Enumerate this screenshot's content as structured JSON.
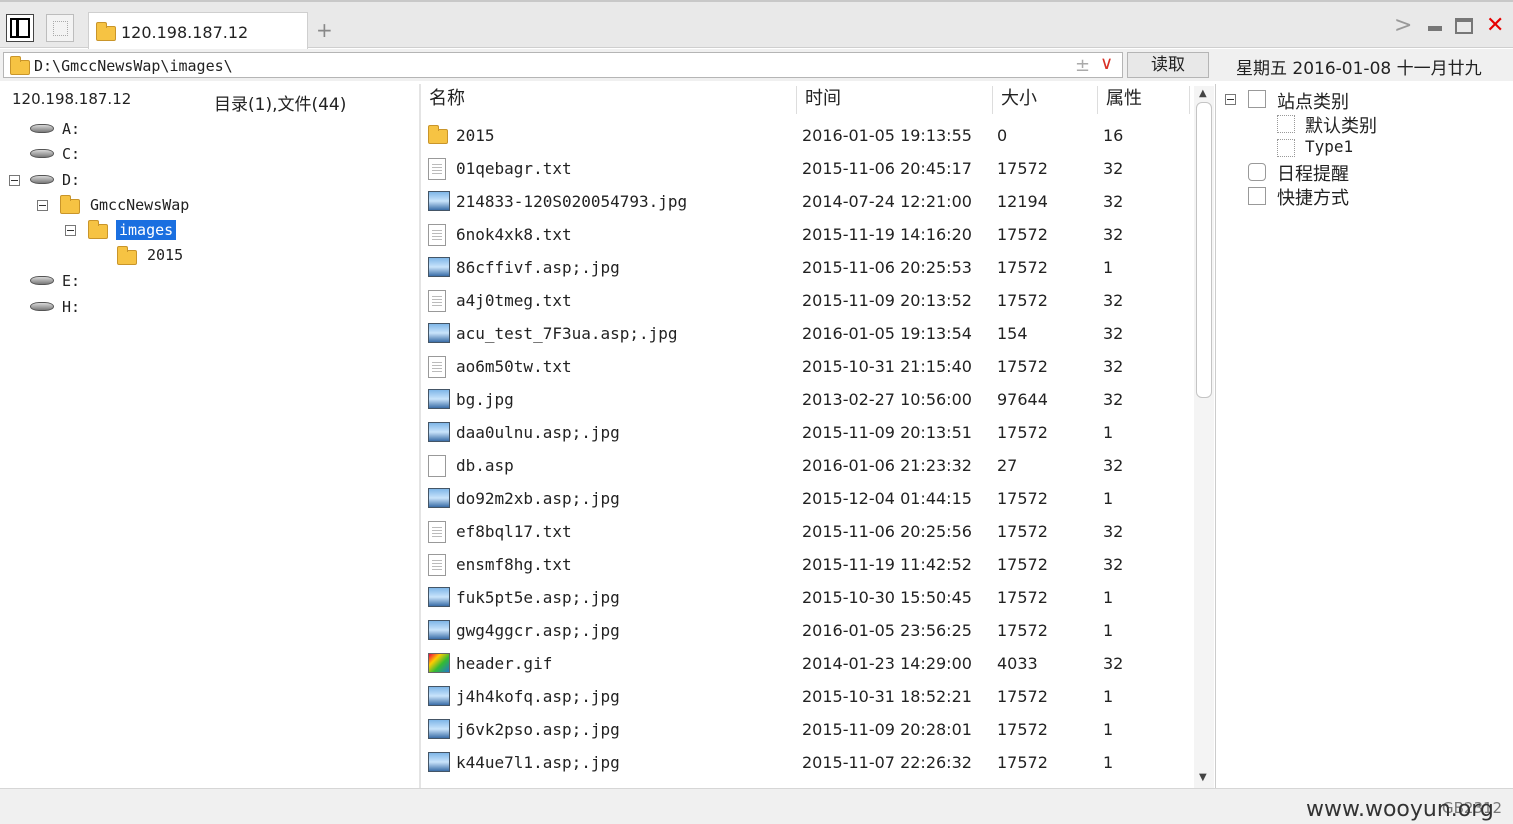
{
  "tabbar": {
    "tab_title": "120.198.187.12"
  },
  "address": {
    "path": "D:\\GmccNewsWap\\images\\",
    "read_button": "读取",
    "date": "星期五 2016-01-08 十一月廿九"
  },
  "left": {
    "host": "120.198.187.12",
    "counts": "目录(1),文件(44)",
    "tree": {
      "a": "A:",
      "c": "C:",
      "d": "D:",
      "gmcc": "GmccNewsWap",
      "images": "images",
      "y2015": "2015",
      "e": "E:",
      "h": "H:"
    }
  },
  "columns": {
    "name": "名称",
    "time": "时间",
    "size": "大小",
    "attr": "属性"
  },
  "files": [
    {
      "type": "folder",
      "name": "2015",
      "time": "2016-01-05 19:13:55",
      "size": "0",
      "attr": "16"
    },
    {
      "type": "txt",
      "name": "01qebagr.txt",
      "time": "2015-11-06 20:45:17",
      "size": "17572",
      "attr": "32"
    },
    {
      "type": "jpg",
      "name": "214833-120S020054793.jpg",
      "time": "2014-07-24 12:21:00",
      "size": "12194",
      "attr": "32"
    },
    {
      "type": "txt",
      "name": "6nok4xk8.txt",
      "time": "2015-11-19 14:16:20",
      "size": "17572",
      "attr": "32"
    },
    {
      "type": "jpg",
      "name": "86cffivf.asp;.jpg",
      "time": "2015-11-06 20:25:53",
      "size": "17572",
      "attr": "1"
    },
    {
      "type": "txt",
      "name": "a4j0tmeg.txt",
      "time": "2015-11-09 20:13:52",
      "size": "17572",
      "attr": "32"
    },
    {
      "type": "jpg",
      "name": "acu_test_7F3ua.asp;.jpg",
      "time": "2016-01-05 19:13:54",
      "size": "154",
      "attr": "32"
    },
    {
      "type": "txt",
      "name": "ao6m50tw.txt",
      "time": "2015-10-31 21:15:40",
      "size": "17572",
      "attr": "32"
    },
    {
      "type": "jpg",
      "name": "bg.jpg",
      "time": "2013-02-27 10:56:00",
      "size": "97644",
      "attr": "32"
    },
    {
      "type": "jpg",
      "name": "daa0ulnu.asp;.jpg",
      "time": "2015-11-09 20:13:51",
      "size": "17572",
      "attr": "1"
    },
    {
      "type": "asp",
      "name": "db.asp",
      "time": "2016-01-06 21:23:32",
      "size": "27",
      "attr": "32"
    },
    {
      "type": "jpg",
      "name": "do92m2xb.asp;.jpg",
      "time": "2015-12-04 01:44:15",
      "size": "17572",
      "attr": "1"
    },
    {
      "type": "txt",
      "name": "ef8bql17.txt",
      "time": "2015-11-06 20:25:56",
      "size": "17572",
      "attr": "32"
    },
    {
      "type": "txt",
      "name": "ensmf8hg.txt",
      "time": "2015-11-19 11:42:52",
      "size": "17572",
      "attr": "32"
    },
    {
      "type": "jpg",
      "name": "fuk5pt5e.asp;.jpg",
      "time": "2015-10-30 15:50:45",
      "size": "17572",
      "attr": "1"
    },
    {
      "type": "jpg",
      "name": "gwg4ggcr.asp;.jpg",
      "time": "2016-01-05 23:56:25",
      "size": "17572",
      "attr": "1"
    },
    {
      "type": "gif",
      "name": "header.gif",
      "time": "2014-01-23 14:29:00",
      "size": "4033",
      "attr": "32"
    },
    {
      "type": "jpg",
      "name": "j4h4kofq.asp;.jpg",
      "time": "2015-10-31 18:52:21",
      "size": "17572",
      "attr": "1"
    },
    {
      "type": "jpg",
      "name": "j6vk2pso.asp;.jpg",
      "time": "2015-11-09 20:28:01",
      "size": "17572",
      "attr": "1"
    },
    {
      "type": "jpg",
      "name": "k44ue7l1.asp;.jpg",
      "time": "2015-11-07 22:26:32",
      "size": "17572",
      "attr": "1"
    }
  ],
  "right": {
    "site_category": "站点类别",
    "default_category": "默认类别",
    "type1": "Type1",
    "schedule": "日程提醒",
    "shortcut": "快捷方式"
  },
  "status": {
    "watermark": "www.wooyun.org",
    "encoding": "GB2312"
  },
  "colors": {
    "selection": "#1a6fe0",
    "close": "#e60000",
    "folder": "#f6c343"
  }
}
